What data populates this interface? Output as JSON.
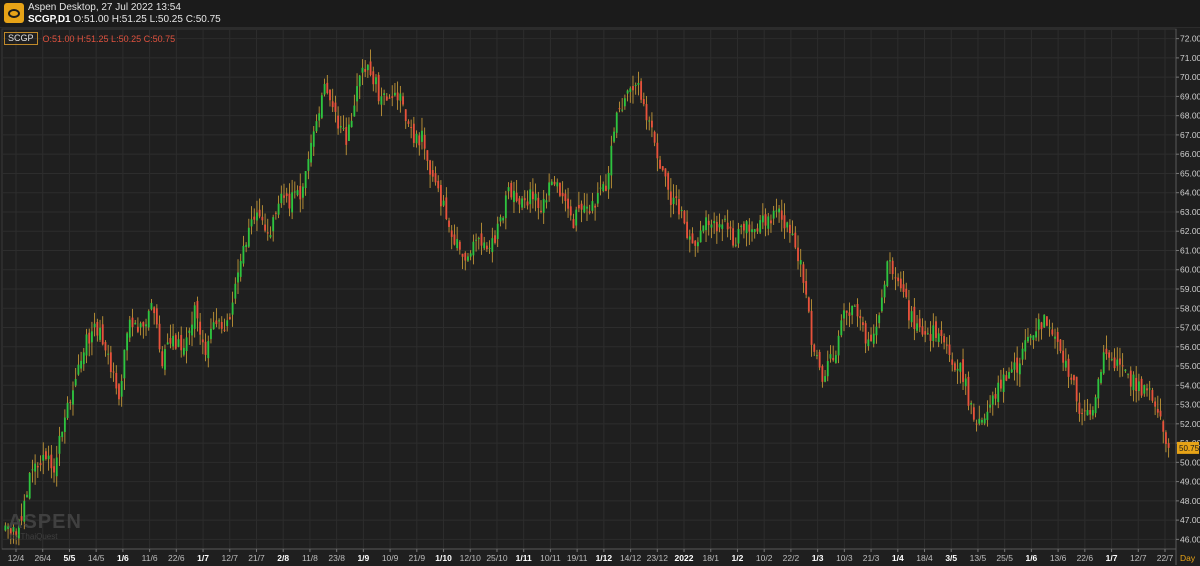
{
  "window": {
    "title": "Aspen Desktop, 27 Jul 2022 13:54",
    "symbol_period": "SCGP,D1",
    "ohlc_text": "O:51.00 H:51.25 L:50.25 C:50.75"
  },
  "legend": {
    "symbol": "SCGP",
    "ohlc_text": "O:51.00 H:51.25 L:50.25 C:50.75"
  },
  "watermark": {
    "main": "ASPEN",
    "sub": "by ThaiQuest"
  },
  "colors": {
    "up": "#2ec43f",
    "down": "#e8523b",
    "wick": "#d4a43a",
    "background": "#1f1f1f",
    "grid": "#2d2d2d",
    "price_tag": "#e7a317"
  },
  "chart_data": {
    "type": "candlestick",
    "symbol": "SCGP",
    "timeframe": "D1",
    "ylim": [
      45.5,
      72.5
    ],
    "y_ticks": [
      "72.00",
      "71.00",
      "70.00",
      "69.00",
      "68.00",
      "67.00",
      "66.00",
      "65.00",
      "64.00",
      "63.00",
      "62.00",
      "61.00",
      "60.00",
      "59.00",
      "58.00",
      "57.00",
      "56.00",
      "55.00",
      "54.00",
      "53.00",
      "52.00",
      "51.00",
      "50.00",
      "49.00",
      "48.00",
      "47.00",
      "46.00"
    ],
    "x_labels": [
      {
        "label": "12/4",
        "bold": false
      },
      {
        "label": "26/4",
        "bold": false
      },
      {
        "label": "5/5",
        "bold": true
      },
      {
        "label": "14/5",
        "bold": false
      },
      {
        "label": "1/6",
        "bold": true
      },
      {
        "label": "11/6",
        "bold": false
      },
      {
        "label": "22/6",
        "bold": false
      },
      {
        "label": "1/7",
        "bold": true
      },
      {
        "label": "12/7",
        "bold": false
      },
      {
        "label": "21/7",
        "bold": false
      },
      {
        "label": "2/8",
        "bold": true
      },
      {
        "label": "11/8",
        "bold": false
      },
      {
        "label": "23/8",
        "bold": false
      },
      {
        "label": "1/9",
        "bold": true
      },
      {
        "label": "10/9",
        "bold": false
      },
      {
        "label": "21/9",
        "bold": false
      },
      {
        "label": "1/10",
        "bold": true
      },
      {
        "label": "12/10",
        "bold": false
      },
      {
        "label": "25/10",
        "bold": false
      },
      {
        "label": "1/11",
        "bold": true
      },
      {
        "label": "10/11",
        "bold": false
      },
      {
        "label": "19/11",
        "bold": false
      },
      {
        "label": "1/12",
        "bold": true
      },
      {
        "label": "14/12",
        "bold": false
      },
      {
        "label": "23/12",
        "bold": false
      },
      {
        "label": "2022",
        "bold": true
      },
      {
        "label": "18/1",
        "bold": false
      },
      {
        "label": "1/2",
        "bold": true
      },
      {
        "label": "10/2",
        "bold": false
      },
      {
        "label": "22/2",
        "bold": false
      },
      {
        "label": "1/3",
        "bold": true
      },
      {
        "label": "10/3",
        "bold": false
      },
      {
        "label": "21/3",
        "bold": false
      },
      {
        "label": "1/4",
        "bold": true
      },
      {
        "label": "18/4",
        "bold": false
      },
      {
        "label": "3/5",
        "bold": true
      },
      {
        "label": "13/5",
        "bold": false
      },
      {
        "label": "25/5",
        "bold": false
      },
      {
        "label": "1/6",
        "bold": true
      },
      {
        "label": "13/6",
        "bold": false
      },
      {
        "label": "22/6",
        "bold": false
      },
      {
        "label": "1/7",
        "bold": true
      },
      {
        "label": "12/7",
        "bold": false
      },
      {
        "label": "22/7",
        "bold": false
      }
    ],
    "period_label": "Day",
    "last_close": "50.75",
    "close_path": [
      {
        "i": 0,
        "c": 46.8
      },
      {
        "i": 4,
        "c": 46.3
      },
      {
        "i": 10,
        "c": 49.6
      },
      {
        "i": 14,
        "c": 50.5
      },
      {
        "i": 18,
        "c": 49.8
      },
      {
        "i": 22,
        "c": 52.5
      },
      {
        "i": 26,
        "c": 54.1
      },
      {
        "i": 30,
        "c": 56.2
      },
      {
        "i": 34,
        "c": 57.0
      },
      {
        "i": 38,
        "c": 55.2
      },
      {
        "i": 42,
        "c": 53.5
      },
      {
        "i": 46,
        "c": 57.5
      },
      {
        "i": 50,
        "c": 57.0
      },
      {
        "i": 54,
        "c": 58.2
      },
      {
        "i": 58,
        "c": 55.4
      },
      {
        "i": 62,
        "c": 56.4
      },
      {
        "i": 66,
        "c": 55.8
      },
      {
        "i": 70,
        "c": 58.0
      },
      {
        "i": 74,
        "c": 55.6
      },
      {
        "i": 78,
        "c": 57.5
      },
      {
        "i": 82,
        "c": 57.0
      },
      {
        "i": 86,
        "c": 59.6
      },
      {
        "i": 90,
        "c": 62.0
      },
      {
        "i": 94,
        "c": 62.8
      },
      {
        "i": 98,
        "c": 62.0
      },
      {
        "i": 102,
        "c": 63.5
      },
      {
        "i": 106,
        "c": 63.6
      },
      {
        "i": 110,
        "c": 64.2
      },
      {
        "i": 114,
        "c": 67.0
      },
      {
        "i": 118,
        "c": 70.0
      },
      {
        "i": 122,
        "c": 68.2
      },
      {
        "i": 126,
        "c": 66.5
      },
      {
        "i": 130,
        "c": 69.5
      },
      {
        "i": 134,
        "c": 70.6
      },
      {
        "i": 138,
        "c": 69.2
      },
      {
        "i": 142,
        "c": 68.5
      },
      {
        "i": 146,
        "c": 69.2
      },
      {
        "i": 150,
        "c": 67.0
      },
      {
        "i": 154,
        "c": 66.8
      },
      {
        "i": 158,
        "c": 64.5
      },
      {
        "i": 162,
        "c": 63.2
      },
      {
        "i": 166,
        "c": 61.5
      },
      {
        "i": 170,
        "c": 60.5
      },
      {
        "i": 174,
        "c": 61.4
      },
      {
        "i": 178,
        "c": 61.0
      },
      {
        "i": 182,
        "c": 62.0
      },
      {
        "i": 186,
        "c": 64.0
      },
      {
        "i": 190,
        "c": 63.4
      },
      {
        "i": 194,
        "c": 63.8
      },
      {
        "i": 198,
        "c": 63.4
      },
      {
        "i": 202,
        "c": 64.4
      },
      {
        "i": 206,
        "c": 64.2
      },
      {
        "i": 210,
        "c": 62.6
      },
      {
        "i": 214,
        "c": 63.0
      },
      {
        "i": 218,
        "c": 63.6
      },
      {
        "i": 222,
        "c": 64.2
      },
      {
        "i": 226,
        "c": 68.0
      },
      {
        "i": 230,
        "c": 69.2
      },
      {
        "i": 234,
        "c": 69.4
      },
      {
        "i": 238,
        "c": 67.5
      },
      {
        "i": 242,
        "c": 65.4
      },
      {
        "i": 246,
        "c": 63.8
      },
      {
        "i": 250,
        "c": 62.8
      },
      {
        "i": 254,
        "c": 61.0
      },
      {
        "i": 258,
        "c": 62.2
      },
      {
        "i": 262,
        "c": 62.5
      },
      {
        "i": 266,
        "c": 62.2
      },
      {
        "i": 270,
        "c": 61.5
      },
      {
        "i": 274,
        "c": 62.5
      },
      {
        "i": 278,
        "c": 62.2
      },
      {
        "i": 282,
        "c": 62.6
      },
      {
        "i": 286,
        "c": 63.2
      },
      {
        "i": 290,
        "c": 62.0
      },
      {
        "i": 294,
        "c": 60.5
      },
      {
        "i": 298,
        "c": 56.5
      },
      {
        "i": 302,
        "c": 54.6
      },
      {
        "i": 306,
        "c": 55.4
      },
      {
        "i": 310,
        "c": 57.5
      },
      {
        "i": 314,
        "c": 57.8
      },
      {
        "i": 318,
        "c": 56.6
      },
      {
        "i": 322,
        "c": 56.8
      },
      {
        "i": 326,
        "c": 60.4
      },
      {
        "i": 330,
        "c": 59.8
      },
      {
        "i": 334,
        "c": 57.6
      },
      {
        "i": 338,
        "c": 56.8
      },
      {
        "i": 342,
        "c": 56.6
      },
      {
        "i": 346,
        "c": 57.0
      },
      {
        "i": 350,
        "c": 55.4
      },
      {
        "i": 354,
        "c": 54.6
      },
      {
        "i": 358,
        "c": 52.0
      },
      {
        "i": 362,
        "c": 52.4
      },
      {
        "i": 366,
        "c": 53.5
      },
      {
        "i": 370,
        "c": 54.6
      },
      {
        "i": 374,
        "c": 55.0
      },
      {
        "i": 378,
        "c": 56.4
      },
      {
        "i": 382,
        "c": 57.2
      },
      {
        "i": 386,
        "c": 57.4
      },
      {
        "i": 390,
        "c": 55.6
      },
      {
        "i": 394,
        "c": 54.4
      },
      {
        "i": 398,
        "c": 52.2
      },
      {
        "i": 402,
        "c": 53.0
      },
      {
        "i": 406,
        "c": 55.6
      },
      {
        "i": 410,
        "c": 55.2
      },
      {
        "i": 414,
        "c": 54.6
      },
      {
        "i": 418,
        "c": 54.0
      },
      {
        "i": 422,
        "c": 53.6
      },
      {
        "i": 426,
        "c": 53.0
      },
      {
        "i": 430,
        "c": 50.75
      }
    ]
  }
}
